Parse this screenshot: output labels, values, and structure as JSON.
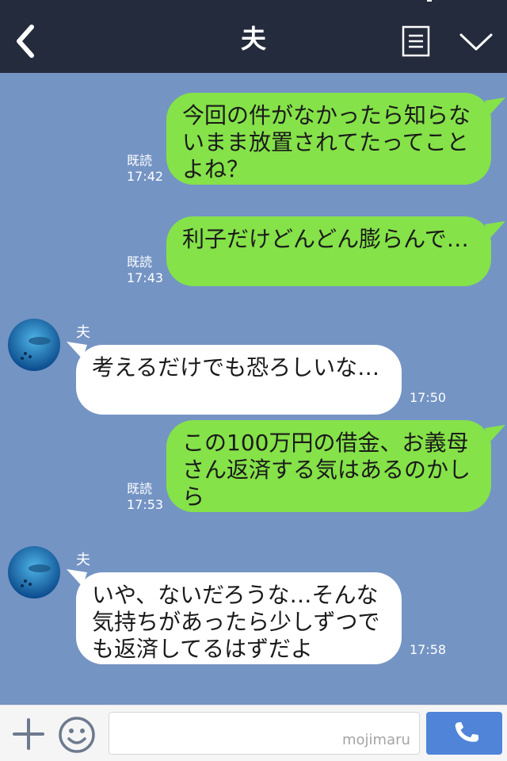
{
  "header": {
    "title": "夫"
  },
  "messages": [
    {
      "sender": "me",
      "text": "今回の件がなかったら知らないまま放置されてたってことよね？",
      "read": "既読",
      "time": "17:42"
    },
    {
      "sender": "me",
      "text": "利子だけどんどん膨らんで…",
      "read": "既読",
      "time": "17:43"
    },
    {
      "sender": "夫",
      "text": "考えるだけでも恐ろしいな…",
      "time": "17:50"
    },
    {
      "sender": "me",
      "text": "この100万円の借金、お義母さん返済する気はあるのかしら",
      "read": "既読",
      "time": "17:53"
    },
    {
      "sender": "夫",
      "text": "いや、ないだろうな…そんな気持ちがあったら少しずつでも返済してるはずだよ",
      "time": "17:58"
    }
  ],
  "footer": {
    "watermark": "mojimaru"
  },
  "icons": {
    "back": "chevron-left-icon",
    "menu": "document-icon",
    "collapse": "chevron-down-icon",
    "add": "plus-icon",
    "emoji": "smiley-icon",
    "call": "phone-icon"
  },
  "colors": {
    "header": "#242b3c",
    "background": "#7494c4",
    "outgoing_bubble": "#85e249",
    "incoming_bubble": "#ffffff",
    "call_button": "#4f84d9"
  }
}
